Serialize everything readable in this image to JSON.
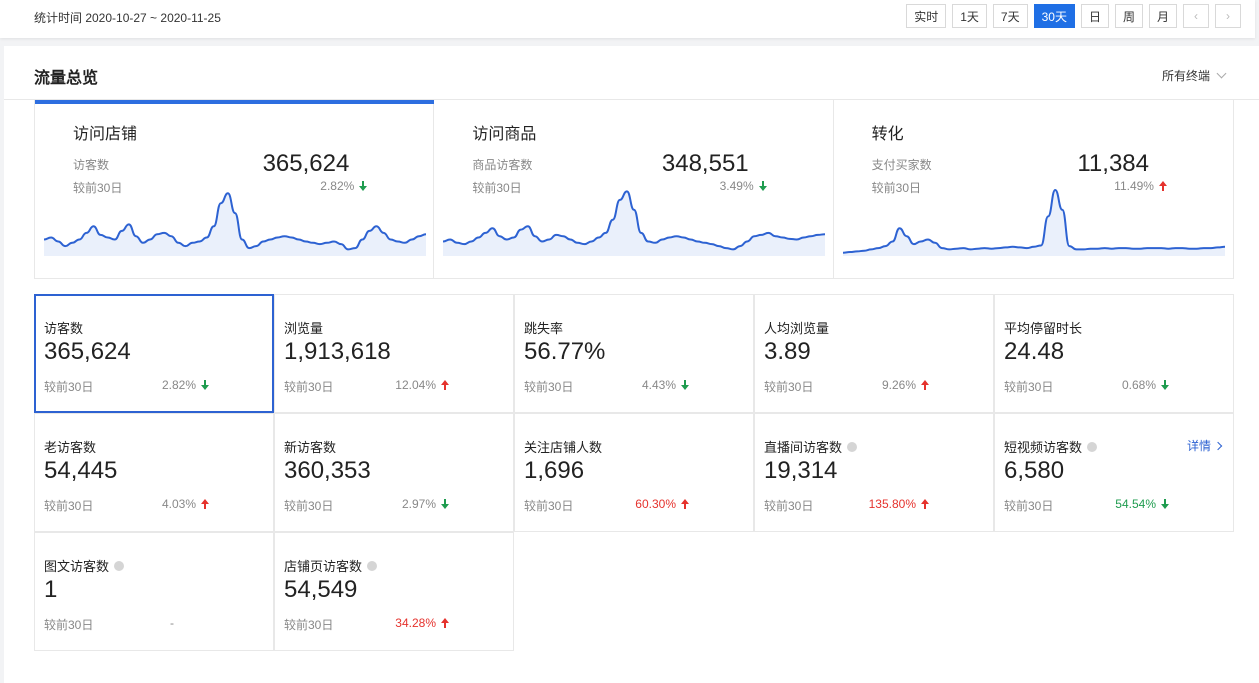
{
  "header": {
    "range_text": "统计时间 2020-10-27 ~ 2020-11-25",
    "buttons": [
      "实时",
      "1天",
      "7天",
      "30天",
      "日",
      "周",
      "月"
    ],
    "active_button": "30天",
    "prev_icon": "chevron-left-icon",
    "next_icon": "chevron-right-icon"
  },
  "panel": {
    "title": "流量总览",
    "terminal": "所有终端"
  },
  "colors": {
    "accent": "#2d6ee0",
    "up": "#e5322d",
    "down": "#1f9c4f",
    "line": "#2d62d2",
    "fill": "#eaf0fb"
  },
  "trend_cards": [
    {
      "title": "访问店铺",
      "sub_label": "访客数",
      "value": "365,624",
      "compare": "较前30日",
      "pct": "2.82%",
      "dir": "down",
      "active": true,
      "series": [
        0.25,
        0.28,
        0.22,
        0.15,
        0.2,
        0.25,
        0.35,
        0.45,
        0.32,
        0.28,
        0.25,
        0.38,
        0.48,
        0.3,
        0.2,
        0.25,
        0.33,
        0.35,
        0.3,
        0.2,
        0.15,
        0.2,
        0.22,
        0.28,
        0.45,
        0.8,
        0.95,
        0.65,
        0.25,
        0.12,
        0.15,
        0.22,
        0.25,
        0.28,
        0.3,
        0.28,
        0.25,
        0.22,
        0.2,
        0.18,
        0.2,
        0.22,
        0.18,
        0.1,
        0.12,
        0.25,
        0.38,
        0.45,
        0.35,
        0.25,
        0.22,
        0.2,
        0.25,
        0.3,
        0.33
      ]
    },
    {
      "title": "访问商品",
      "sub_label": "商品访客数",
      "value": "348,551",
      "compare": "较前30日",
      "pct": "3.49%",
      "dir": "down",
      "active": false,
      "series": [
        0.22,
        0.25,
        0.2,
        0.18,
        0.22,
        0.28,
        0.35,
        0.42,
        0.3,
        0.25,
        0.28,
        0.4,
        0.45,
        0.3,
        0.22,
        0.25,
        0.32,
        0.3,
        0.25,
        0.2,
        0.18,
        0.22,
        0.28,
        0.35,
        0.55,
        0.85,
        0.98,
        0.7,
        0.35,
        0.22,
        0.2,
        0.25,
        0.28,
        0.3,
        0.28,
        0.25,
        0.22,
        0.2,
        0.18,
        0.15,
        0.12,
        0.1,
        0.15,
        0.22,
        0.3,
        0.32,
        0.35,
        0.3,
        0.28,
        0.26,
        0.25,
        0.28,
        0.3,
        0.32,
        0.33
      ]
    },
    {
      "title": "转化",
      "sub_label": "支付买家数",
      "value": "11,384",
      "compare": "较前30日",
      "pct": "11.49%",
      "dir": "up",
      "active": false,
      "series": [
        0.05,
        0.06,
        0.07,
        0.08,
        0.1,
        0.12,
        0.15,
        0.22,
        0.42,
        0.3,
        0.18,
        0.22,
        0.25,
        0.2,
        0.12,
        0.1,
        0.11,
        0.12,
        0.1,
        0.11,
        0.12,
        0.11,
        0.12,
        0.13,
        0.14,
        0.13,
        0.12,
        0.14,
        0.16,
        0.6,
        1.0,
        0.7,
        0.15,
        0.1,
        0.1,
        0.11,
        0.11,
        0.12,
        0.11,
        0.12,
        0.12,
        0.11,
        0.11,
        0.12,
        0.12,
        0.12,
        0.11,
        0.12,
        0.12,
        0.11,
        0.11,
        0.12,
        0.12,
        0.13,
        0.14
      ]
    }
  ],
  "metrics": [
    {
      "label": "访客数",
      "value": "365,624",
      "compare": "较前30日",
      "pct": "2.82%",
      "dir": "down",
      "color": "neutral",
      "info": false,
      "selected": true
    },
    {
      "label": "浏览量",
      "value": "1,913,618",
      "compare": "较前30日",
      "pct": "12.04%",
      "dir": "up",
      "color": "neutral",
      "info": false
    },
    {
      "label": "跳失率",
      "value": "56.77%",
      "compare": "较前30日",
      "pct": "4.43%",
      "dir": "down",
      "color": "neutral",
      "info": false
    },
    {
      "label": "人均浏览量",
      "value": "3.89",
      "compare": "较前30日",
      "pct": "9.26%",
      "dir": "up",
      "color": "neutral",
      "info": false
    },
    {
      "label": "平均停留时长",
      "value": "24.48",
      "compare": "较前30日",
      "pct": "0.68%",
      "dir": "down",
      "color": "neutral",
      "info": false
    },
    {
      "label": "老访客数",
      "value": "54,445",
      "compare": "较前30日",
      "pct": "4.03%",
      "dir": "up",
      "color": "neutral",
      "info": false
    },
    {
      "label": "新访客数",
      "value": "360,353",
      "compare": "较前30日",
      "pct": "2.97%",
      "dir": "down",
      "color": "neutral",
      "info": false
    },
    {
      "label": "关注店铺人数",
      "value": "1,696",
      "compare": "较前30日",
      "pct": "60.30%",
      "dir": "up",
      "color": "red",
      "info": false
    },
    {
      "label": "直播间访客数",
      "value": "19,314",
      "compare": "较前30日",
      "pct": "135.80%",
      "dir": "up",
      "color": "red",
      "info": true
    },
    {
      "label": "短视频访客数",
      "value": "6,580",
      "compare": "较前30日",
      "pct": "54.54%",
      "dir": "down",
      "color": "green",
      "info": true,
      "detail": "详情"
    },
    {
      "label": "图文访客数",
      "value": "1",
      "compare": "较前30日",
      "pct": "-",
      "dir": "none",
      "color": "neutral",
      "info": true
    },
    {
      "label": "店铺页访客数",
      "value": "54,549",
      "compare": "较前30日",
      "pct": "34.28%",
      "dir": "up",
      "color": "red",
      "info": true
    }
  ]
}
